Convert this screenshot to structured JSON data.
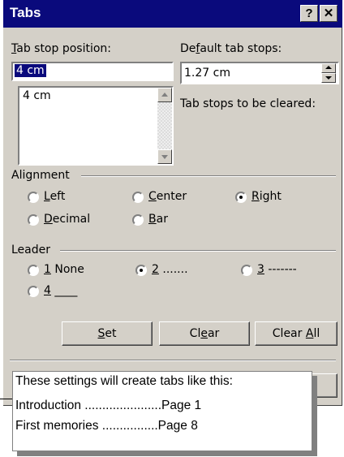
{
  "dialog": {
    "title": "Tabs",
    "help_btn": "?",
    "close_btn": "✕",
    "tab_stop_position": {
      "label_pre": "",
      "label_u": "T",
      "label_post": "ab stop position:",
      "value": "4 cm",
      "list_items": [
        "4 cm"
      ]
    },
    "default_tab_stops": {
      "label_pre": "De",
      "label_u": "f",
      "label_post": "ault tab stops:",
      "value": "1.27 cm"
    },
    "tab_stops_cleared_label": "Tab stops to be cleared:",
    "alignment": {
      "title": "Alignment",
      "options": [
        {
          "u": "L",
          "rest": "eft",
          "checked": false
        },
        {
          "u": "C",
          "rest": "enter",
          "checked": false
        },
        {
          "u": "R",
          "rest": "ight",
          "checked": true
        },
        {
          "u": "D",
          "rest": "ecimal",
          "checked": false
        },
        {
          "u": "B",
          "rest": "ar",
          "checked": false
        }
      ]
    },
    "leader": {
      "title": "Leader",
      "options": [
        {
          "u": "1",
          "rest": " None",
          "checked": false
        },
        {
          "u": "2",
          "rest": " .......",
          "checked": true
        },
        {
          "u": "3",
          "rest": " -------",
          "checked": false
        },
        {
          "u": "4",
          "rest": " ____",
          "checked": false
        }
      ]
    },
    "buttons": {
      "set": {
        "u": "S",
        "rest": "et"
      },
      "clear": {
        "pre": "Cl",
        "u": "e",
        "rest": "ar"
      },
      "clear_all": {
        "pre": "Clear ",
        "u": "A",
        "rest": "ll"
      }
    }
  },
  "callout": {
    "line1": "These settings will create tabs like this:",
    "line2": "Introduction ......................Page 1",
    "line3": "First memories ................Page 8"
  }
}
